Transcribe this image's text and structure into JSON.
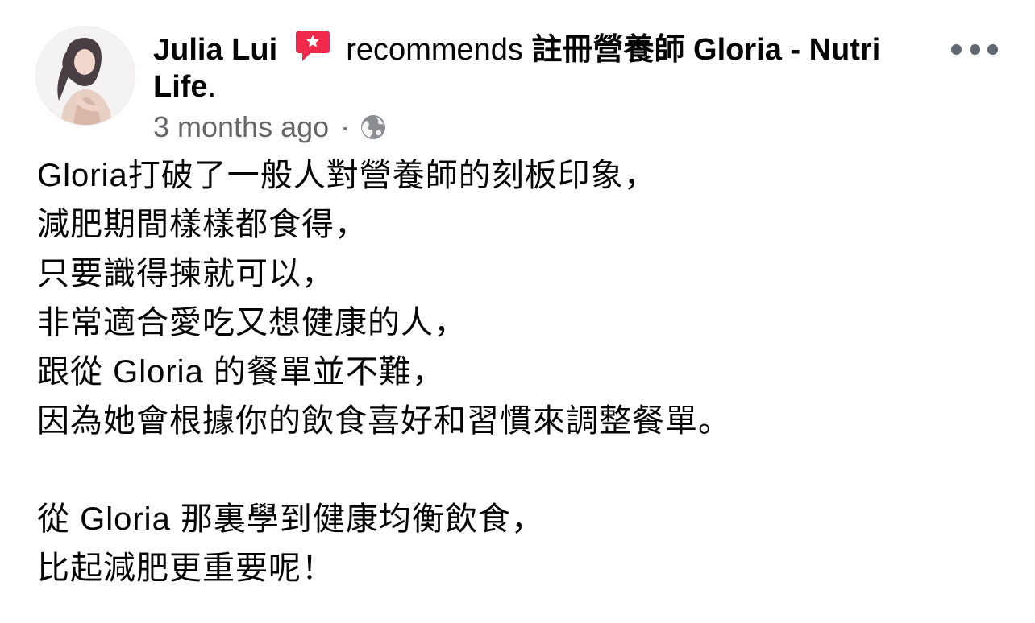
{
  "post": {
    "author": "Julia Lui",
    "verb": "recommends",
    "page_name": "註冊營養師 Gloria - Nutri Life",
    "page_suffix": ".",
    "timestamp": "3 months ago",
    "separator": "·",
    "privacy_icon": "globe-icon",
    "recommend_icon": "recommend-badge-icon",
    "more_icon": "more-options-icon",
    "accent_color": "#f02849",
    "paragraphs": [
      [
        "Gloria打破了一般人對營養師的刻板印象，",
        "減肥期間樣樣都食得，",
        "只要識得揀就可以，",
        "非常適合愛吃又想健康的人，",
        "跟從 Gloria 的餐單並不難，",
        "因為她會根據你的飲食喜好和習慣來調整餐單。"
      ],
      [
        "從 Gloria 那裏學到健康均衡飲食，",
        "比起減肥更重要呢！"
      ]
    ]
  }
}
